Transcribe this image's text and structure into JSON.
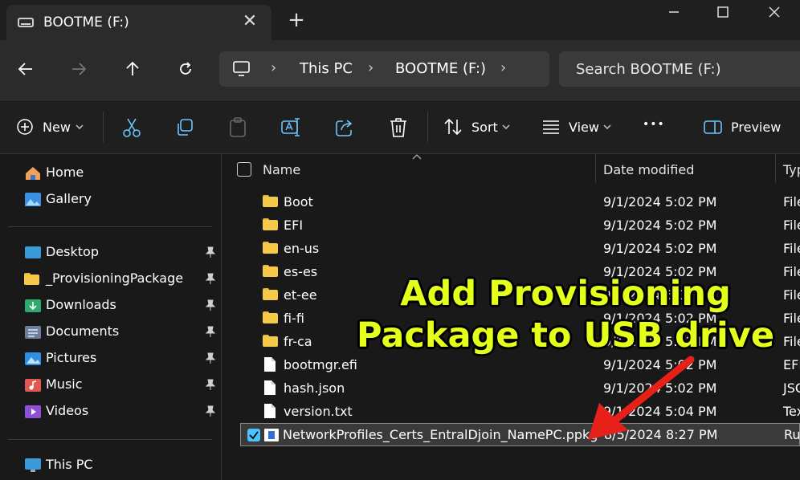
{
  "window": {
    "tab_title": "BOOTME (F:)",
    "close_tab_glyph": "✕",
    "new_tab_glyph": "+"
  },
  "nav": {
    "breadcrumbs": [
      "This PC",
      "BOOTME (F:)"
    ],
    "search_placeholder": "Search BOOTME (F:)"
  },
  "toolbar": {
    "new_label": "New",
    "sort_label": "Sort",
    "view_label": "View",
    "more_glyph": "•••",
    "preview_label": "Preview"
  },
  "sidebar": {
    "top": [
      {
        "label": "Home",
        "icon": "home-icon"
      },
      {
        "label": "Gallery",
        "icon": "gallery-icon"
      }
    ],
    "pinned": [
      {
        "label": "Desktop",
        "icon": "desktop-icon"
      },
      {
        "label": "_ProvisioningPackage",
        "icon": "folder-icon"
      },
      {
        "label": "Downloads",
        "icon": "downloads-icon"
      },
      {
        "label": "Documents",
        "icon": "documents-icon"
      },
      {
        "label": "Pictures",
        "icon": "pictures-icon"
      },
      {
        "label": "Music",
        "icon": "music-icon"
      },
      {
        "label": "Videos",
        "icon": "videos-icon"
      }
    ],
    "bottom": [
      {
        "label": "This PC",
        "icon": "this-pc-icon"
      }
    ]
  },
  "columns": {
    "name": "Name",
    "date": "Date modified",
    "type": "Typ"
  },
  "files": [
    {
      "name": "Boot",
      "date": "9/1/2024 5:02 PM",
      "type": "File",
      "kind": "folder"
    },
    {
      "name": "EFI",
      "date": "9/1/2024 5:02 PM",
      "type": "File",
      "kind": "folder"
    },
    {
      "name": "en-us",
      "date": "9/1/2024 5:02 PM",
      "type": "File",
      "kind": "folder"
    },
    {
      "name": "es-es",
      "date": "9/1/2024 5:02 PM",
      "type": "File",
      "kind": "folder"
    },
    {
      "name": "et-ee",
      "date": "9/1/2024 5:02 PM",
      "type": "File",
      "kind": "folder"
    },
    {
      "name": "fi-fi",
      "date": "9/1/2024 5:02 PM",
      "type": "File",
      "kind": "folder"
    },
    {
      "name": "fr-ca",
      "date": "9/1/2024 5:02 PM",
      "type": "File",
      "kind": "folder"
    },
    {
      "name": "bootmgr.efi",
      "date": "9/1/2024 5:02 PM",
      "type": "EFI",
      "kind": "file"
    },
    {
      "name": "hash.json",
      "date": "9/1/2024 5:02 PM",
      "type": "JSC",
      "kind": "file"
    },
    {
      "name": "version.txt",
      "date": "9/1/2024 5:04 PM",
      "type": "Tex",
      "kind": "file"
    },
    {
      "name": "NetworkProfiles_Certs_EntralDjoin_NamePC.ppkg",
      "date": "8/5/2024 8:27 PM",
      "type": "Ru",
      "kind": "ppkg",
      "selected": true
    }
  ],
  "overlay": {
    "line1": "Add Provisioning",
    "line2": "Package to USB drive",
    "color": "#e4ff1a",
    "arrow_color": "#e8201a"
  }
}
